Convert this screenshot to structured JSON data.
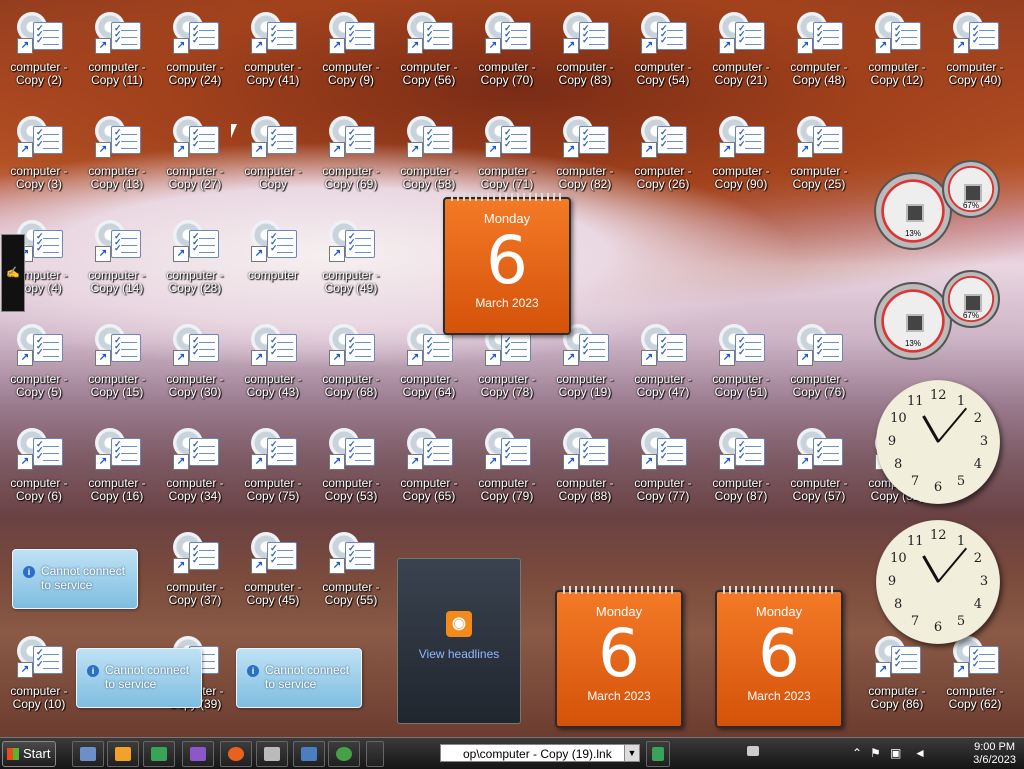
{
  "desktop": {
    "icons": [
      {
        "line1": "computer -",
        "line2": "Copy (2)"
      },
      {
        "line1": "computer -",
        "line2": "Copy (11)"
      },
      {
        "line1": "computer -",
        "line2": "Copy (24)"
      },
      {
        "line1": "computer -",
        "line2": "Copy (41)"
      },
      {
        "line1": "computer -",
        "line2": "Copy (9)"
      },
      {
        "line1": "computer -",
        "line2": "Copy (56)"
      },
      {
        "line1": "computer -",
        "line2": "Copy (70)"
      },
      {
        "line1": "computer -",
        "line2": "Copy (83)"
      },
      {
        "line1": "computer -",
        "line2": "Copy (54)"
      },
      {
        "line1": "computer -",
        "line2": "Copy (21)"
      },
      {
        "line1": "computer -",
        "line2": "Copy (48)"
      },
      {
        "line1": "computer -",
        "line2": "Copy (12)"
      },
      {
        "line1": "computer -",
        "line2": "Copy (40)"
      },
      {
        "line1": "computer -",
        "line2": "Copy (3)"
      },
      {
        "line1": "computer -",
        "line2": "Copy (13)"
      },
      {
        "line1": "computer -",
        "line2": "Copy (27)"
      },
      {
        "line1": "computer -",
        "line2": "Copy"
      },
      {
        "line1": "computer -",
        "line2": "Copy (69)"
      },
      {
        "line1": "computer -",
        "line2": "Copy (58)"
      },
      {
        "line1": "computer -",
        "line2": "Copy (71)"
      },
      {
        "line1": "computer -",
        "line2": "Copy (82)"
      },
      {
        "line1": "computer -",
        "line2": "Copy (26)"
      },
      {
        "line1": "computer -",
        "line2": "Copy (90)"
      },
      {
        "line1": "computer -",
        "line2": "Copy (25)"
      },
      {
        "line1": "computer -",
        "line2": "Copy (4)"
      },
      {
        "line1": "computer -",
        "line2": "Copy (14)"
      },
      {
        "line1": "computer -",
        "line2": "Copy (28)"
      },
      {
        "line1": "computer",
        "line2": ""
      },
      {
        "line1": "computer -",
        "line2": "Copy (49)"
      },
      {
        "line1": "computer -",
        "line2": "Copy (5)"
      },
      {
        "line1": "computer -",
        "line2": "Copy (15)"
      },
      {
        "line1": "computer -",
        "line2": "Copy (30)"
      },
      {
        "line1": "computer -",
        "line2": "Copy (43)"
      },
      {
        "line1": "computer -",
        "line2": "Copy (68)"
      },
      {
        "line1": "computer -",
        "line2": "Copy (64)"
      },
      {
        "line1": "computer -",
        "line2": "Copy (78)"
      },
      {
        "line1": "computer -",
        "line2": "Copy (19)"
      },
      {
        "line1": "computer -",
        "line2": "Copy (47)"
      },
      {
        "line1": "computer -",
        "line2": "Copy (51)"
      },
      {
        "line1": "computer -",
        "line2": "Copy (76)"
      },
      {
        "line1": "computer -",
        "line2": "Copy (6)"
      },
      {
        "line1": "computer -",
        "line2": "Copy (16)"
      },
      {
        "line1": "computer -",
        "line2": "Copy (34)"
      },
      {
        "line1": "computer -",
        "line2": "Copy (75)"
      },
      {
        "line1": "computer -",
        "line2": "Copy (53)"
      },
      {
        "line1": "computer -",
        "line2": "Copy (65)"
      },
      {
        "line1": "computer -",
        "line2": "Copy (79)"
      },
      {
        "line1": "computer -",
        "line2": "Copy (88)"
      },
      {
        "line1": "computer -",
        "line2": "Copy (77)"
      },
      {
        "line1": "computer -",
        "line2": "Copy (87)"
      },
      {
        "line1": "computer -",
        "line2": "Copy (57)"
      },
      {
        "line1": "computer -",
        "line2": "Copy (32)"
      },
      {
        "line1": "computer -",
        "line2": "Copy (37)"
      },
      {
        "line1": "computer -",
        "line2": "Copy (45)"
      },
      {
        "line1": "computer -",
        "line2": "Copy (55)"
      },
      {
        "line1": "computer -",
        "line2": "Copy (10)"
      },
      {
        "line1": "computer -",
        "line2": "Copy (39)"
      },
      {
        "line1": "computer -",
        "line2": "Copy (86)"
      },
      {
        "line1": "computer -",
        "line2": "Copy (62)"
      }
    ]
  },
  "gadgets": {
    "calendars": [
      {
        "day": "Monday",
        "date": "6",
        "month": "March 2023"
      },
      {
        "day": "Monday",
        "date": "6",
        "month": "March 2023"
      },
      {
        "day": "Monday",
        "date": "6",
        "month": "March 2023"
      }
    ],
    "cpu_meters": [
      {
        "cpu": "13%",
        "memory": "67%"
      },
      {
        "cpu": "13%",
        "memory": "67%"
      }
    ],
    "clock_numbers": [
      "12",
      "1",
      "2",
      "3",
      "4",
      "5",
      "6",
      "7",
      "8",
      "9",
      "10",
      "11"
    ],
    "notices": [
      {
        "line1": "Cannot connect",
        "line2": "to service"
      },
      {
        "line1": "Cannot connect",
        "line2": "to service"
      },
      {
        "line1": "Cannot connect",
        "line2": "to service"
      }
    ],
    "feed": {
      "label": "View headlines"
    }
  },
  "taskbar": {
    "start_label": "Start",
    "address_value": "op\\computer - Copy (19).lnk",
    "time": "9:00 PM",
    "date": "3/6/2023",
    "accent": "#f47a26"
  }
}
